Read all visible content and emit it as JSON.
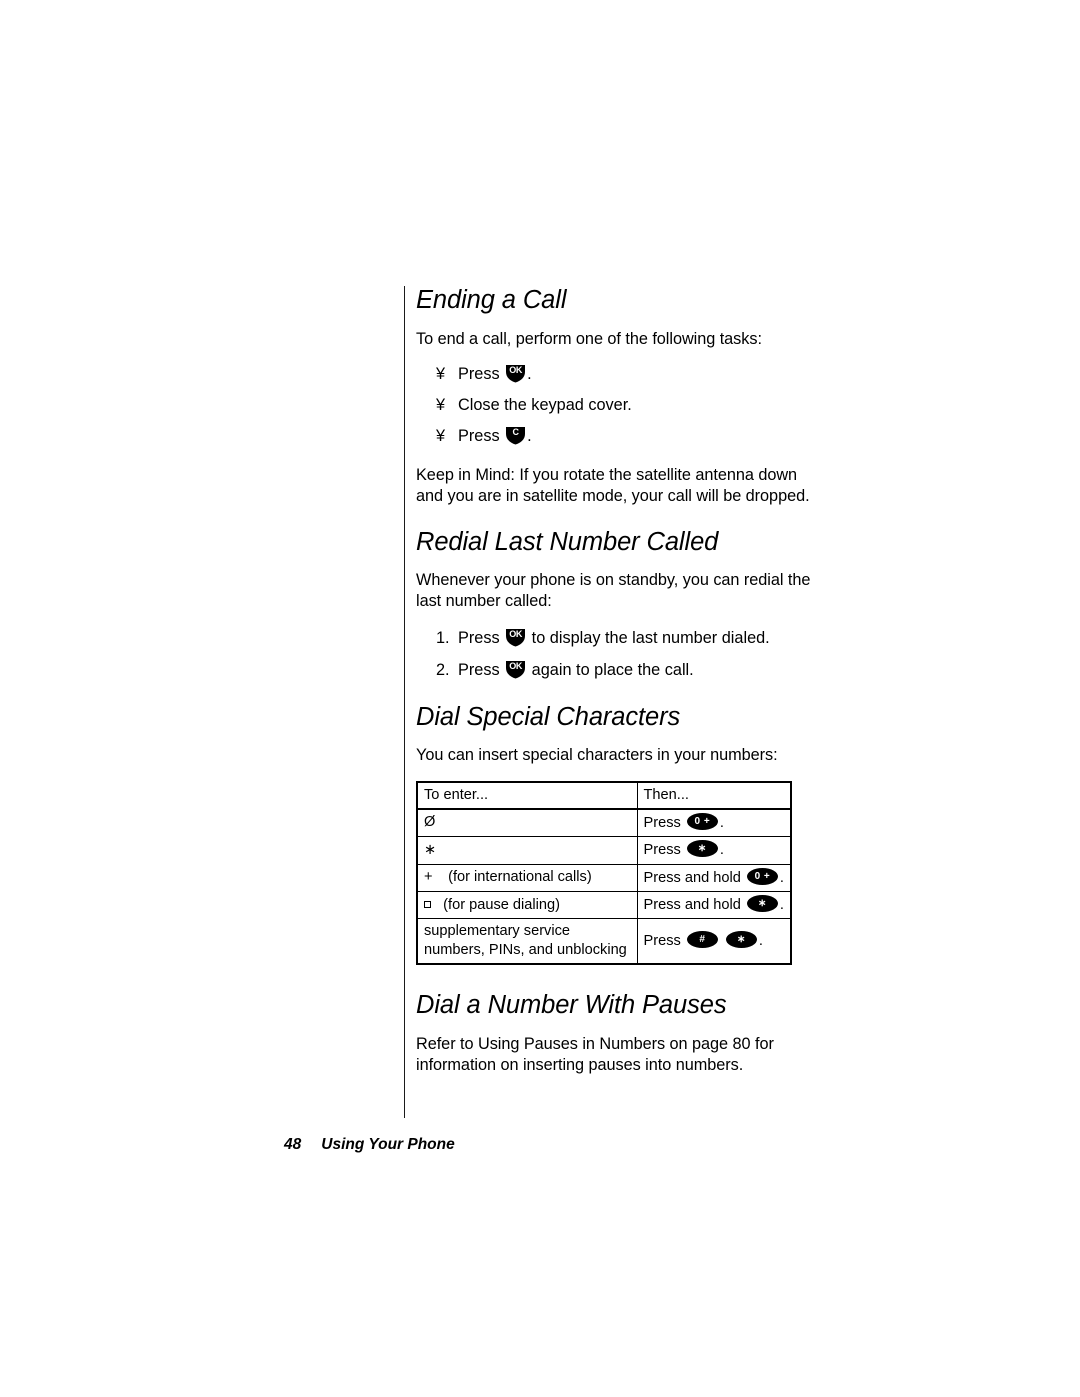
{
  "document": {
    "page_number": "48",
    "footer_title": "Using Your Phone"
  },
  "sections": [
    {
      "heading": "Ending a Call",
      "intro": "To end a call, perform one of the following tasks:",
      "bullets": [
        {
          "marker": "¥",
          "before": "Press ",
          "key": "OK",
          "after": "."
        },
        {
          "marker": "¥",
          "before": "Close  the keypad cover.",
          "key": "",
          "after": ""
        },
        {
          "marker": "¥",
          "before": "Press ",
          "key": "C",
          "after": "."
        }
      ],
      "note": "Keep in Mind:  If you rotate the satellite antenna down and you are in satellite mode, your call will be dropped."
    },
    {
      "heading": "Redial Last Number Called",
      "intro": "Whenever your phone is on standby, you can redial the last number called:",
      "steps": [
        {
          "marker": "1.",
          "before": "Press ",
          "key": "OK",
          "after": " to display the last number dialed."
        },
        {
          "marker": "2.",
          "before": "Press ",
          "key": "OK",
          "after": " again to place the call."
        }
      ]
    },
    {
      "heading": "Dial Special Characters",
      "intro": "You can insert special characters in your numbers:"
    },
    {
      "heading": "Dial a Number With Pauses",
      "body": "Refer to  Using Pauses in Numbers  on page 80 for information on inserting pauses into numbers."
    }
  ],
  "table": {
    "headers": [
      "To enter...",
      "Then..."
    ],
    "rows": [
      {
        "enter_glyph": "Ø",
        "enter_note": "",
        "then_before": "Press ",
        "then_keys": [
          "0 +"
        ],
        "then_after": "."
      },
      {
        "enter_glyph": "∗",
        "enter_note": "",
        "then_before": "Press ",
        "then_keys": [
          "∗"
        ],
        "then_after": "."
      },
      {
        "enter_glyph": "+",
        "enter_note": "(for international calls)",
        "then_before": "Press and hold ",
        "then_keys": [
          "0 +"
        ],
        "then_after": "."
      },
      {
        "enter_glyph": "square",
        "enter_note": "(for pause dialing)",
        "then_before": "Press and hold ",
        "then_keys": [
          "∗"
        ],
        "then_after": "."
      },
      {
        "enter_glyph": "",
        "enter_note": "supplementary service numbers, PINs, and unblocking",
        "then_before": "Press ",
        "then_keys": [
          "#",
          "∗"
        ],
        "then_after": "."
      }
    ]
  },
  "icons": {
    "ok_key_label": "OK",
    "c_key_label": "C",
    "zero_plus_label": "0 +",
    "star_label": "∗",
    "hash_label": "#"
  }
}
